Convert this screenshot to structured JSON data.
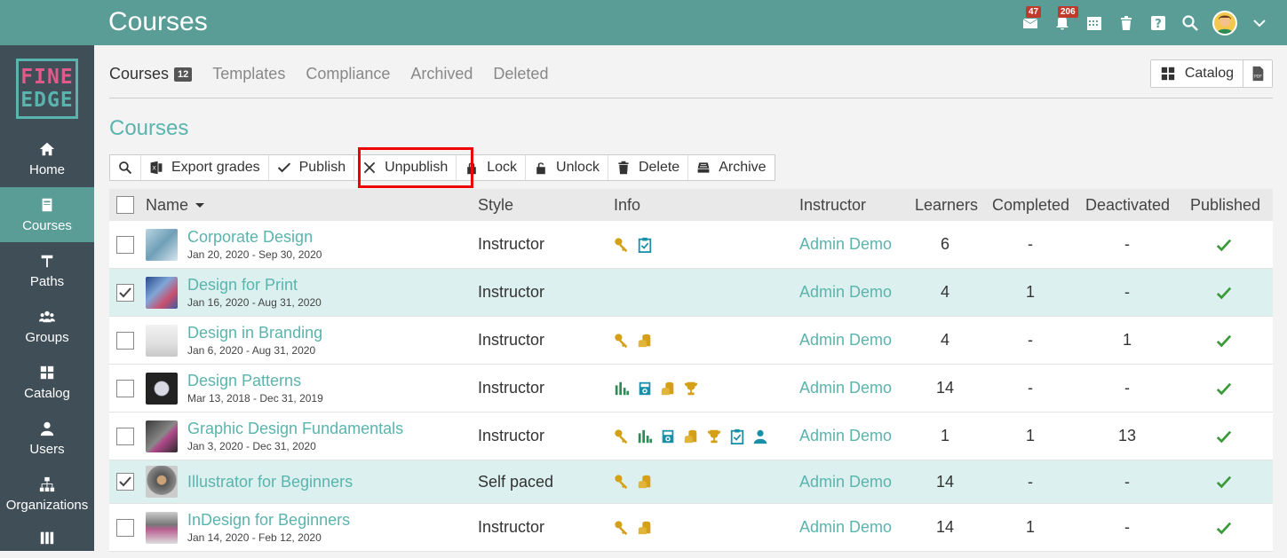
{
  "app": {
    "title": "Courses"
  },
  "topbar": {
    "messages_count": "47",
    "notifications_count": "206"
  },
  "logo": {
    "line1": "FINE",
    "line2": "EDGE"
  },
  "sidebar": {
    "items": [
      {
        "label": "Home",
        "icon": "home-icon"
      },
      {
        "label": "Courses",
        "icon": "book-icon",
        "active": true
      },
      {
        "label": "Paths",
        "icon": "signpost-icon"
      },
      {
        "label": "Groups",
        "icon": "group-icon"
      },
      {
        "label": "Catalog",
        "icon": "grid-icon"
      },
      {
        "label": "Users",
        "icon": "user-icon"
      },
      {
        "label": "Organizations",
        "icon": "org-icon"
      }
    ]
  },
  "tabs": [
    {
      "label": "Courses",
      "count": "12",
      "active": true
    },
    {
      "label": "Templates"
    },
    {
      "label": "Compliance"
    },
    {
      "label": "Archived"
    },
    {
      "label": "Deleted"
    }
  ],
  "top_actions": {
    "catalog_label": "Catalog"
  },
  "section": {
    "title": "Courses"
  },
  "toolbar": {
    "export_label": "Export grades",
    "publish_label": "Publish",
    "unpublish_label": "Unpublish",
    "lock_label": "Lock",
    "unlock_label": "Unlock",
    "delete_label": "Delete",
    "archive_label": "Archive"
  },
  "table": {
    "headers": {
      "name": "Name",
      "style": "Style",
      "info": "Info",
      "instructor": "Instructor",
      "learners": "Learners",
      "completed": "Completed",
      "deactivated": "Deactivated",
      "published": "Published"
    },
    "rows": [
      {
        "name": "Corporate Design",
        "dates": "Jan 20, 2020 - Sep 30, 2020",
        "style": "Instructor",
        "instructor": "Admin Demo",
        "learners": "6",
        "completed": "-",
        "deactivated": "-",
        "selected": false
      },
      {
        "name": "Design for Print",
        "dates": "Jan 16, 2020 - Aug 31, 2020",
        "style": "Instructor",
        "instructor": "Admin Demo",
        "learners": "4",
        "completed": "1",
        "deactivated": "-",
        "selected": true
      },
      {
        "name": "Design in Branding",
        "dates": "Jan 6, 2020 - Aug 31, 2020",
        "style": "Instructor",
        "instructor": "Admin Demo",
        "learners": "4",
        "completed": "-",
        "deactivated": "1",
        "selected": false
      },
      {
        "name": "Design Patterns",
        "dates": "Mar 13, 2018 - Dec 31, 2019",
        "style": "Instructor",
        "instructor": "Admin Demo",
        "learners": "14",
        "completed": "-",
        "deactivated": "-",
        "selected": false
      },
      {
        "name": "Graphic Design Fundamentals",
        "dates": "Jan 3, 2020 - Dec 31, 2020",
        "style": "Instructor",
        "instructor": "Admin Demo",
        "learners": "1",
        "completed": "1",
        "deactivated": "13",
        "selected": false
      },
      {
        "name": "Illustrator for Beginners",
        "dates": "",
        "style": "Self paced",
        "instructor": "Admin Demo",
        "learners": "14",
        "completed": "-",
        "deactivated": "-",
        "selected": true
      },
      {
        "name": "InDesign for Beginners",
        "dates": "Jan 14, 2020 - Feb 12, 2020",
        "style": "Instructor",
        "instructor": "Admin Demo",
        "learners": "14",
        "completed": "1",
        "deactivated": "-",
        "selected": false
      }
    ]
  },
  "colors": {
    "topbar": "#5a9d96",
    "sidebar": "#3f4e57",
    "accent": "#5ab4ad",
    "gold": "#d4a017",
    "highlight": "#e00000",
    "published": "#3a9a3a"
  }
}
